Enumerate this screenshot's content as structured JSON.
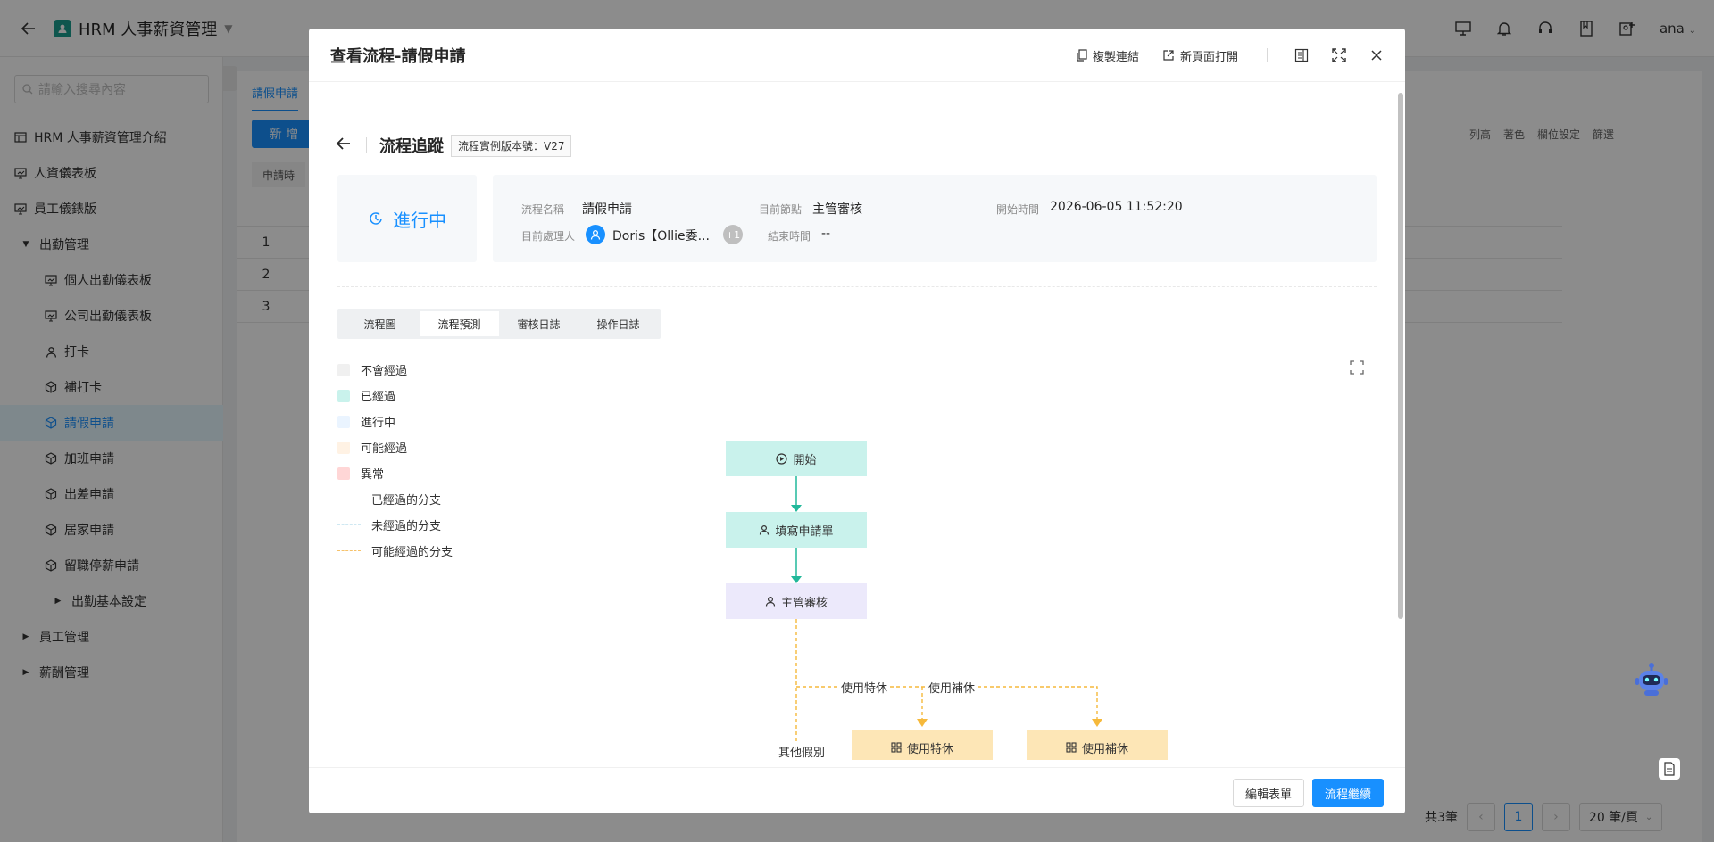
{
  "app": {
    "title": "HRM 人事薪資管理",
    "user": "ana"
  },
  "sidebar": {
    "search_placeholder": "請輸入搜尋內容",
    "items": [
      {
        "label": "HRM 人事薪資管理介紹",
        "icon": "table-icon",
        "level": 0
      },
      {
        "label": "人資儀表板",
        "icon": "dashboard-icon",
        "level": 0
      },
      {
        "label": "員工儀錶版",
        "icon": "dashboard-icon",
        "level": 0
      },
      {
        "label": "出勤管理",
        "icon": "caret-down-icon",
        "level": 0
      },
      {
        "label": "個人出勤儀表板",
        "icon": "dashboard-icon",
        "level": 1
      },
      {
        "label": "公司出勤儀表板",
        "icon": "dashboard-icon",
        "level": 1
      },
      {
        "label": "打卡",
        "icon": "user-icon",
        "level": 1
      },
      {
        "label": "補打卡",
        "icon": "cube-icon",
        "level": 1
      },
      {
        "label": "請假申請",
        "icon": "cube-icon",
        "level": 1,
        "active": true
      },
      {
        "label": "加班申請",
        "icon": "cube-icon",
        "level": 1
      },
      {
        "label": "出差申請",
        "icon": "cube-icon",
        "level": 1
      },
      {
        "label": "居家申請",
        "icon": "cube-icon",
        "level": 1
      },
      {
        "label": "留職停薪申請",
        "icon": "cube-icon",
        "level": 1
      },
      {
        "label": "出勤基本設定",
        "icon": "caret-right-icon",
        "level": 1
      },
      {
        "label": "員工管理",
        "icon": "caret-right-icon",
        "level": 0
      },
      {
        "label": "薪酬管理",
        "icon": "caret-right-icon",
        "level": 0
      }
    ]
  },
  "content": {
    "tab": "請假申請",
    "add_button": "新 增",
    "filter_chip": "申請時",
    "tools": [
      "列高",
      "著色",
      "欄位設定",
      "篩選"
    ],
    "rows": [
      "1",
      "2",
      "3"
    ],
    "pager": {
      "total": "共3筆",
      "page": "1",
      "size": "20 筆/頁"
    }
  },
  "modal": {
    "title": "查看流程-請假申請",
    "actions": {
      "copy_link": "複製連結",
      "open_new": "新頁面打開"
    },
    "trace_title": "流程追蹤",
    "version": "流程實例版本號：V27",
    "status": "進行中",
    "info": {
      "flow_name_label": "流程名稱",
      "flow_name": "請假申請",
      "node_label": "目前節點",
      "node": "主管審核",
      "start_label": "開始時間",
      "start": "2026-06-05 11:52:20",
      "handler_label": "目前處理人",
      "handler": "Doris【Ollie委...",
      "handler_more": "+1",
      "end_label": "結束時間",
      "end": "--"
    },
    "tabs": [
      "流程圖",
      "流程預測",
      "審核日誌",
      "操作日誌"
    ],
    "selected_tab": "流程預測",
    "legend": [
      {
        "label": "不會經過",
        "color": "#f0f0f0"
      },
      {
        "label": "已經過",
        "color": "#c9f2ec"
      },
      {
        "label": "進行中",
        "color": "#eaf4ff"
      },
      {
        "label": "可能經過",
        "color": "#fff2e4"
      },
      {
        "label": "異常",
        "color": "#ffd6d6"
      },
      {
        "label": "已經過的分支",
        "color": "#3cc7a9"
      },
      {
        "label": "未經過的分支",
        "color": "#cfe8f2"
      },
      {
        "label": "可能經過的分支",
        "color": "#f6c26b"
      }
    ],
    "flow": {
      "start": "開始",
      "fill_form": "填寫申請單",
      "manager": "主管審核",
      "branch_special": "使用特休",
      "branch_comp": "使用補休",
      "branch_other": "其他假別",
      "node_special": "使用特休",
      "node_comp": "使用補休"
    },
    "footer": {
      "edit": "編輯表單",
      "continue": "流程繼續"
    }
  }
}
